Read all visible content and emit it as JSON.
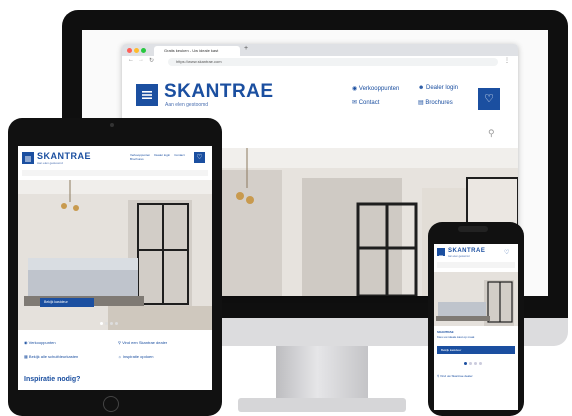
{
  "brand": {
    "name": "SKANTRAE",
    "tagline": "Aan elen gestoomd",
    "primary_color": "#1b4fa0"
  },
  "desktop": {
    "tab_title": "Gratis keuken - Uw ideale kast",
    "url": "https://www.skantrae.com",
    "nav": {
      "verkooppunten": "Verkooppunten",
      "dealer_login": "Dealer login",
      "contact": "Contact",
      "brochures": "Brochures"
    }
  },
  "tablet": {
    "nav_items": [
      "Verkooppunten",
      "Dealer login",
      "Contact",
      "Brochures"
    ],
    "hero_button": "Bekijk kastdeur",
    "features": [
      "Verkooppunten",
      "Vind een Skantrae dealer",
      "Bekijk alle schuifdeurkasten",
      "Inspiratie opdoen"
    ],
    "section_title": "Inspiratie nodig?"
  },
  "phone": {
    "section_label": "SKANTRAE",
    "hero_text": "Kies uw ideale kast op maat",
    "hero_button": "Bekijk kastdeur",
    "feature": "Vind uw Skantrae dealer"
  },
  "icons": [
    "hamburger-icon",
    "heart-icon",
    "search-icon",
    "location-pin-icon",
    "user-icon",
    "mail-icon",
    "brochure-icon"
  ]
}
